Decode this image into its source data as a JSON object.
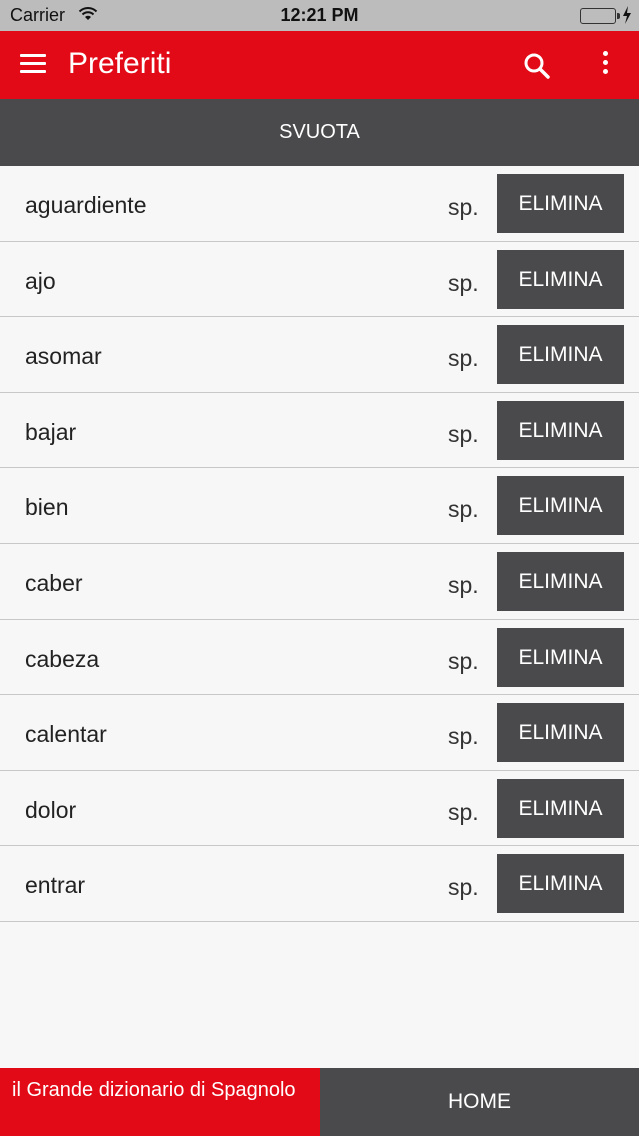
{
  "status": {
    "carrier": "Carrier",
    "time": "12:21 PM"
  },
  "app_bar": {
    "title": "Preferiti"
  },
  "actions": {
    "clear_label": "SVUOTA"
  },
  "colors": {
    "brand_red": "#e20a16",
    "dark_gray": "#4a4a4c",
    "battery_green": "#4cd964"
  },
  "favorites": [
    {
      "word": "aguardiente",
      "lang": "sp.",
      "delete_label": "ELIMINA"
    },
    {
      "word": "ajo",
      "lang": "sp.",
      "delete_label": "ELIMINA"
    },
    {
      "word": "asomar",
      "lang": "sp.",
      "delete_label": "ELIMINA"
    },
    {
      "word": "bajar",
      "lang": "sp.",
      "delete_label": "ELIMINA"
    },
    {
      "word": "bien",
      "lang": "sp.",
      "delete_label": "ELIMINA"
    },
    {
      "word": "caber",
      "lang": "sp.",
      "delete_label": "ELIMINA"
    },
    {
      "word": "cabeza",
      "lang": "sp.",
      "delete_label": "ELIMINA"
    },
    {
      "word": "calentar",
      "lang": "sp.",
      "delete_label": "ELIMINA"
    },
    {
      "word": "dolor",
      "lang": "sp.",
      "delete_label": "ELIMINA"
    },
    {
      "word": "entrar",
      "lang": "sp.",
      "delete_label": "ELIMINA"
    }
  ],
  "footer": {
    "brand": "il Grande dizionario di Spagnolo",
    "home_label": "HOME"
  }
}
